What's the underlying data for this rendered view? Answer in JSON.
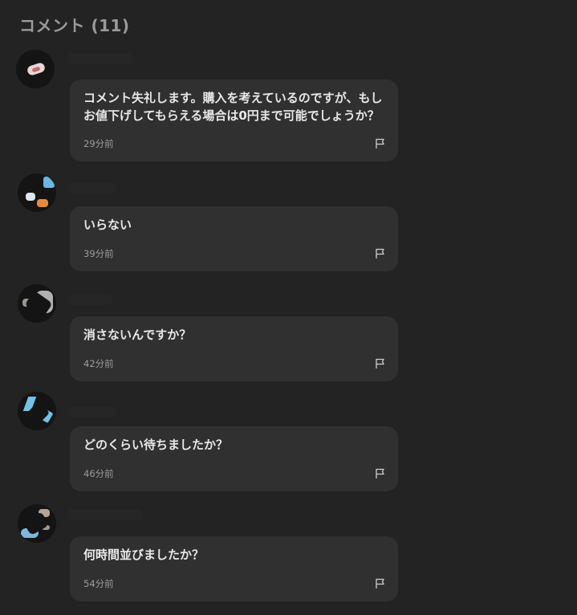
{
  "header": {
    "title": "コメント (11)"
  },
  "comments": [
    {
      "text": "コメント失礼します。購入を考えているのですが、もしお値下げしてもらえる場合は0円まで可能でしょうか？",
      "time": "29分前"
    },
    {
      "text": "いらない",
      "time": "39分前"
    },
    {
      "text": "消さないんですか？",
      "time": "42分前"
    },
    {
      "text": "どのくらい待ちましたか？",
      "time": "46分前"
    },
    {
      "text": "何時間並びましたか？",
      "time": "54分前"
    }
  ],
  "icons": {
    "flag": "flag-icon"
  },
  "colors": {
    "background": "#232323",
    "bubble": "#303030",
    "text": "#e8e8e8",
    "muted": "#9c9c9c"
  }
}
